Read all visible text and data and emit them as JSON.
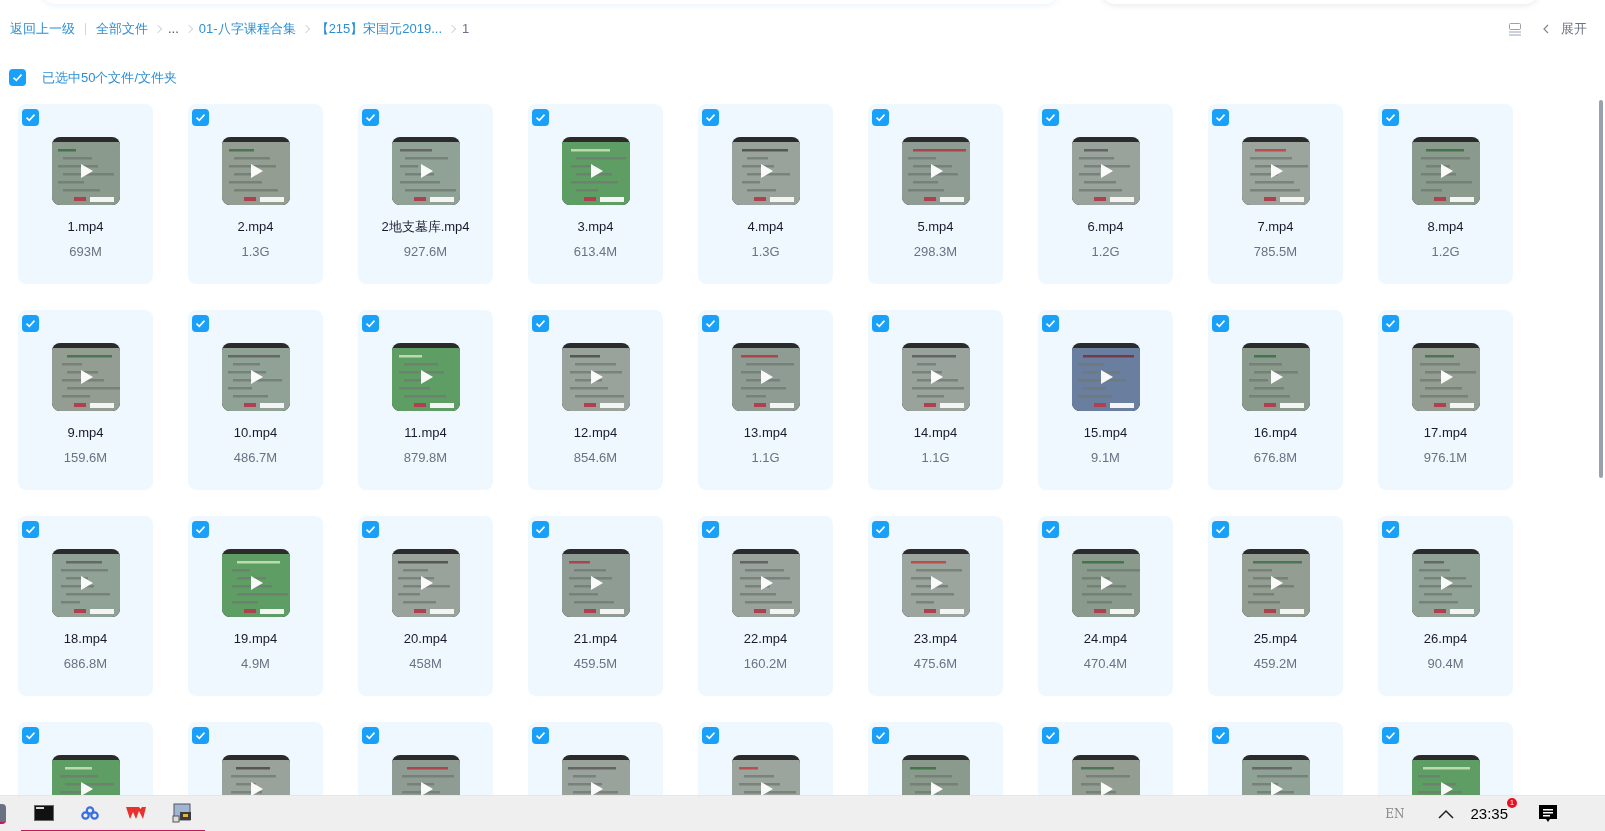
{
  "breadcrumb": {
    "back": "返回上一级",
    "items": [
      {
        "label": "全部文件",
        "kind": "link"
      },
      {
        "label": "...",
        "kind": "ellipsis"
      },
      {
        "label": "01-八字课程合集",
        "kind": "link"
      },
      {
        "label": "【215】宋国元2019...",
        "kind": "link"
      },
      {
        "label": "1",
        "kind": "current"
      }
    ]
  },
  "toolbar": {
    "expand": "展开"
  },
  "select_all": {
    "checked": true,
    "label": "已选中50个文件/文件夹"
  },
  "files": [
    {
      "name": "1.mp4",
      "size": "693M",
      "checked": true
    },
    {
      "name": "2.mp4",
      "size": "1.3G",
      "checked": true
    },
    {
      "name": "2地支墓库.mp4",
      "size": "927.6M",
      "checked": true
    },
    {
      "name": "3.mp4",
      "size": "613.4M",
      "checked": true
    },
    {
      "name": "4.mp4",
      "size": "1.3G",
      "checked": true
    },
    {
      "name": "5.mp4",
      "size": "298.3M",
      "checked": true
    },
    {
      "name": "6.mp4",
      "size": "1.2G",
      "checked": true
    },
    {
      "name": "7.mp4",
      "size": "785.5M",
      "checked": true
    },
    {
      "name": "8.mp4",
      "size": "1.2G",
      "checked": true
    },
    {
      "name": "9.mp4",
      "size": "159.6M",
      "checked": true
    },
    {
      "name": "10.mp4",
      "size": "486.7M",
      "checked": true
    },
    {
      "name": "11.mp4",
      "size": "879.8M",
      "checked": true
    },
    {
      "name": "12.mp4",
      "size": "854.6M",
      "checked": true
    },
    {
      "name": "13.mp4",
      "size": "1.1G",
      "checked": true
    },
    {
      "name": "14.mp4",
      "size": "1.1G",
      "checked": true
    },
    {
      "name": "15.mp4",
      "size": "9.1M",
      "checked": true
    },
    {
      "name": "16.mp4",
      "size": "676.8M",
      "checked": true
    },
    {
      "name": "17.mp4",
      "size": "976.1M",
      "checked": true
    },
    {
      "name": "18.mp4",
      "size": "686.8M",
      "checked": true
    },
    {
      "name": "19.mp4",
      "size": "4.9M",
      "checked": true
    },
    {
      "name": "20.mp4",
      "size": "458M",
      "checked": true
    },
    {
      "name": "21.mp4",
      "size": "459.5M",
      "checked": true
    },
    {
      "name": "22.mp4",
      "size": "160.2M",
      "checked": true
    },
    {
      "name": "23.mp4",
      "size": "475.6M",
      "checked": true
    },
    {
      "name": "24.mp4",
      "size": "470.4M",
      "checked": true
    },
    {
      "name": "25.mp4",
      "size": "459.2M",
      "checked": true
    },
    {
      "name": "26.mp4",
      "size": "90.4M",
      "checked": true
    },
    {
      "checked": true
    },
    {
      "checked": true
    },
    {
      "checked": true
    },
    {
      "checked": true
    },
    {
      "checked": true
    },
    {
      "checked": true
    },
    {
      "checked": true
    },
    {
      "checked": true
    },
    {
      "checked": true
    }
  ],
  "taskbar": {
    "language": "EN",
    "time": "23:35",
    "badge": "1"
  }
}
